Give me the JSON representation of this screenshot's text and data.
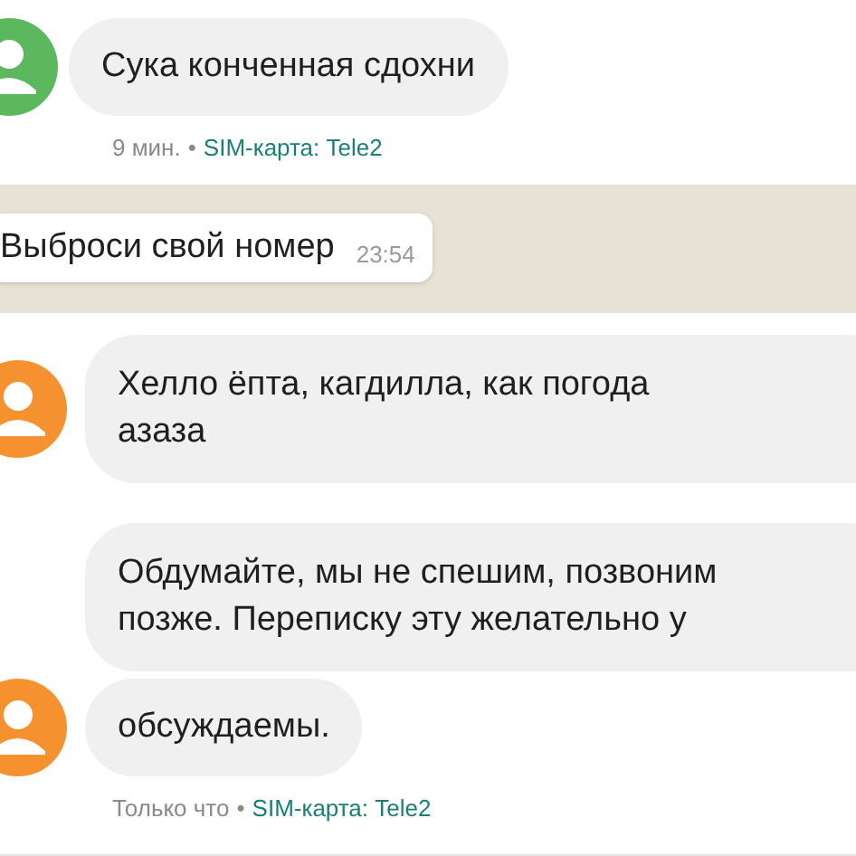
{
  "sections": [
    {
      "kind": "sms",
      "messages": [
        {
          "lines": [
            "Сука конченная сдохни"
          ],
          "avatar": {
            "color": "#5cb85c"
          }
        }
      ],
      "meta": {
        "time": "9 мин.",
        "separator": "•",
        "sim": "SIM-карта: Tele2"
      }
    },
    {
      "kind": "whatsapp",
      "messages": [
        {
          "lines": [
            "Выброси свой номер"
          ],
          "time": "23:54"
        }
      ]
    },
    {
      "kind": "sms",
      "messages": [
        {
          "lines": [
            "Хелло ёпта, кагдилла, как погода",
            "азаза"
          ],
          "avatar": {
            "color": "#f5922f"
          }
        },
        {
          "lines": [
            "Обдумайте, мы не спешим, позвоним",
            "позже. Переписку эту желательно у"
          ]
        },
        {
          "lines": [
            "обсуждаемы."
          ],
          "avatar": {
            "color": "#f5922f"
          }
        }
      ],
      "meta": {
        "time": "Только что",
        "separator": "•",
        "sim": "SIM-карта: Tele2"
      }
    }
  ]
}
